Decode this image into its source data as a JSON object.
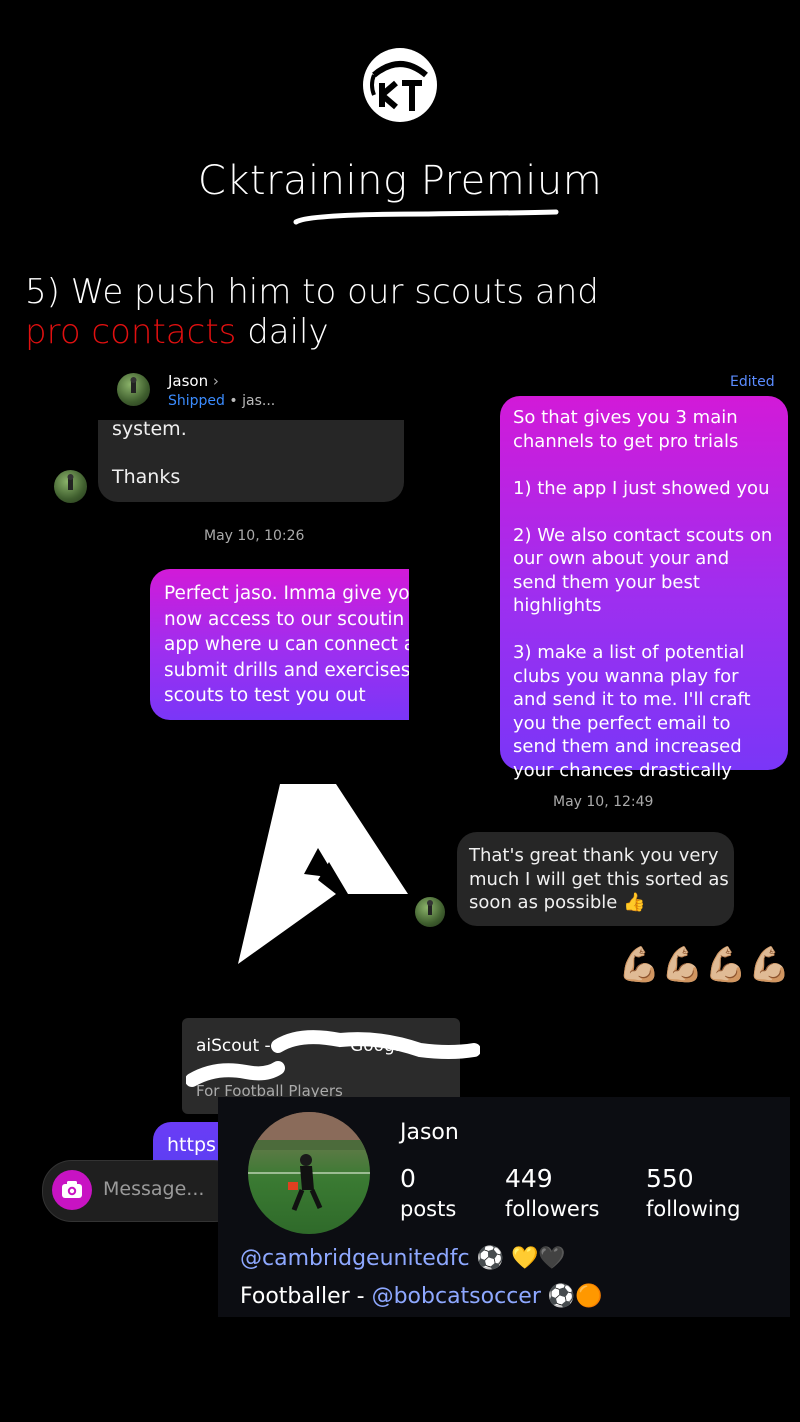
{
  "brand": {
    "title": "Cktraining Premium"
  },
  "headline": {
    "prefix": "5) We push him to our scouts and",
    "highlight": "pro contacts",
    "suffix": "daily"
  },
  "chat": {
    "contact_name": "Jason",
    "contact_chevron": "›",
    "contact_status": "Shipped",
    "contact_separator": "•",
    "contact_handle": "jas...",
    "edited_label": "Edited",
    "bubble_partial_1": "system.",
    "bubble_partial_2": "Thanks",
    "timestamp_1": "May 10, 10:26",
    "sent_cut": "Perfect jaso. Imma give yo\nnow access to our scoutin\napp where u can connect a\nsubmit drills and exercises\nscouts to test you out",
    "sent_main": "So that gives you 3 main channels to get pro trials\n\n1) the app I just showed you\n\n2) We also contact scouts on our own about your and send them your best highlights\n\n3) make a list of potential clubs you wanna play for and send it to me. I'll craft you the perfect email to send them and increased your chances drastically",
    "timestamp_2": "May 10, 12:49",
    "reply": "That's great thank you very much I will get this sorted as soon as possible 👍",
    "reaction": "💪🏼💪🏼💪🏼💪🏼",
    "link_title": "aiScout - ",
    "link_title_tail": "Google",
    "link_desc": "For Football Players",
    "link_url": "https:",
    "message_placeholder": "Message..."
  },
  "profile": {
    "name": "Jason",
    "posts_count": "0",
    "posts_label": "posts",
    "followers_count": "449",
    "followers_label": "followers",
    "following_count": "550",
    "following_label": "following",
    "bio_mention_1": "@cambridgeunitedfc",
    "bio_emoji_1": "⚽ 💛🖤",
    "bio_text_2": "Footballer - ",
    "bio_mention_2": "@bobcatsoccer",
    "bio_emoji_2": "⚽🟠"
  },
  "icons": {
    "logo": "ckt-monogram-logo",
    "camera": "camera-icon",
    "big_a": "aiscout-a-logo"
  },
  "colors": {
    "accent_red": "#e01010",
    "bubble_gradient_top": "#d21ad8",
    "bubble_gradient_bottom": "#7a36f7",
    "link_blue": "#3b8cff"
  }
}
